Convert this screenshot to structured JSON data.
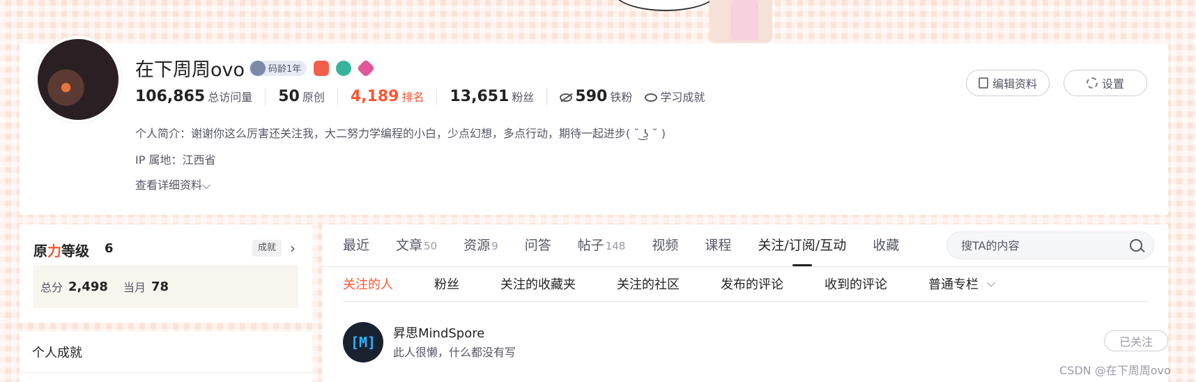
{
  "profile": {
    "username": "在下周周ovo",
    "code_age_badge": "码龄1年",
    "stats": [
      {
        "value": "106,865",
        "label": "总访问量"
      },
      {
        "value": "50",
        "label": "原创"
      },
      {
        "value": "4,189",
        "label": "排名"
      },
      {
        "value": "13,651",
        "label": "粉丝"
      },
      {
        "value": "590",
        "label": "铁粉"
      }
    ],
    "achievement_link": "学习成就",
    "bio": "个人简介：谢谢你这么厉害还关注我，大二努力学编程的小白，少点幻想，多点行动，期待一起进步( ˘ ͜ʖ ˘ )",
    "ip": "IP 属地：江西省",
    "more_info": "查看详细资料",
    "edit_button": "编辑资料",
    "settings_button": "设置"
  },
  "level": {
    "title_prefix": "原",
    "title_highlight": "力",
    "title_suffix": "等级",
    "level": "6",
    "achievements_chip": "成就",
    "total_label": "总分",
    "total_value": "2,498",
    "month_label": "当月",
    "month_value": "78"
  },
  "personal_achievements": "个人成就",
  "tabs": [
    {
      "label": "最近",
      "count": ""
    },
    {
      "label": "文章",
      "count": "50"
    },
    {
      "label": "资源",
      "count": "9"
    },
    {
      "label": "问答",
      "count": ""
    },
    {
      "label": "帖子",
      "count": "148"
    },
    {
      "label": "视频",
      "count": ""
    },
    {
      "label": "课程",
      "count": ""
    },
    {
      "label": "关注/订阅/互动",
      "count": ""
    },
    {
      "label": "收藏",
      "count": ""
    }
  ],
  "search": {
    "placeholder": "搜TA的内容"
  },
  "subtabs": [
    "关注的人",
    "粉丝",
    "关注的收藏夹",
    "关注的社区",
    "发布的评论",
    "收到的评论",
    "普通专栏"
  ],
  "following": [
    {
      "avatar_text": "[M]",
      "name": "昇思MindSpore",
      "desc": "此人很懒，什么都没有写",
      "button": "已关注"
    }
  ],
  "watermark": "CSDN @在下周周ovo",
  "colors": {
    "accent": "#fc5531",
    "text": "#222226",
    "muted": "#555666"
  }
}
